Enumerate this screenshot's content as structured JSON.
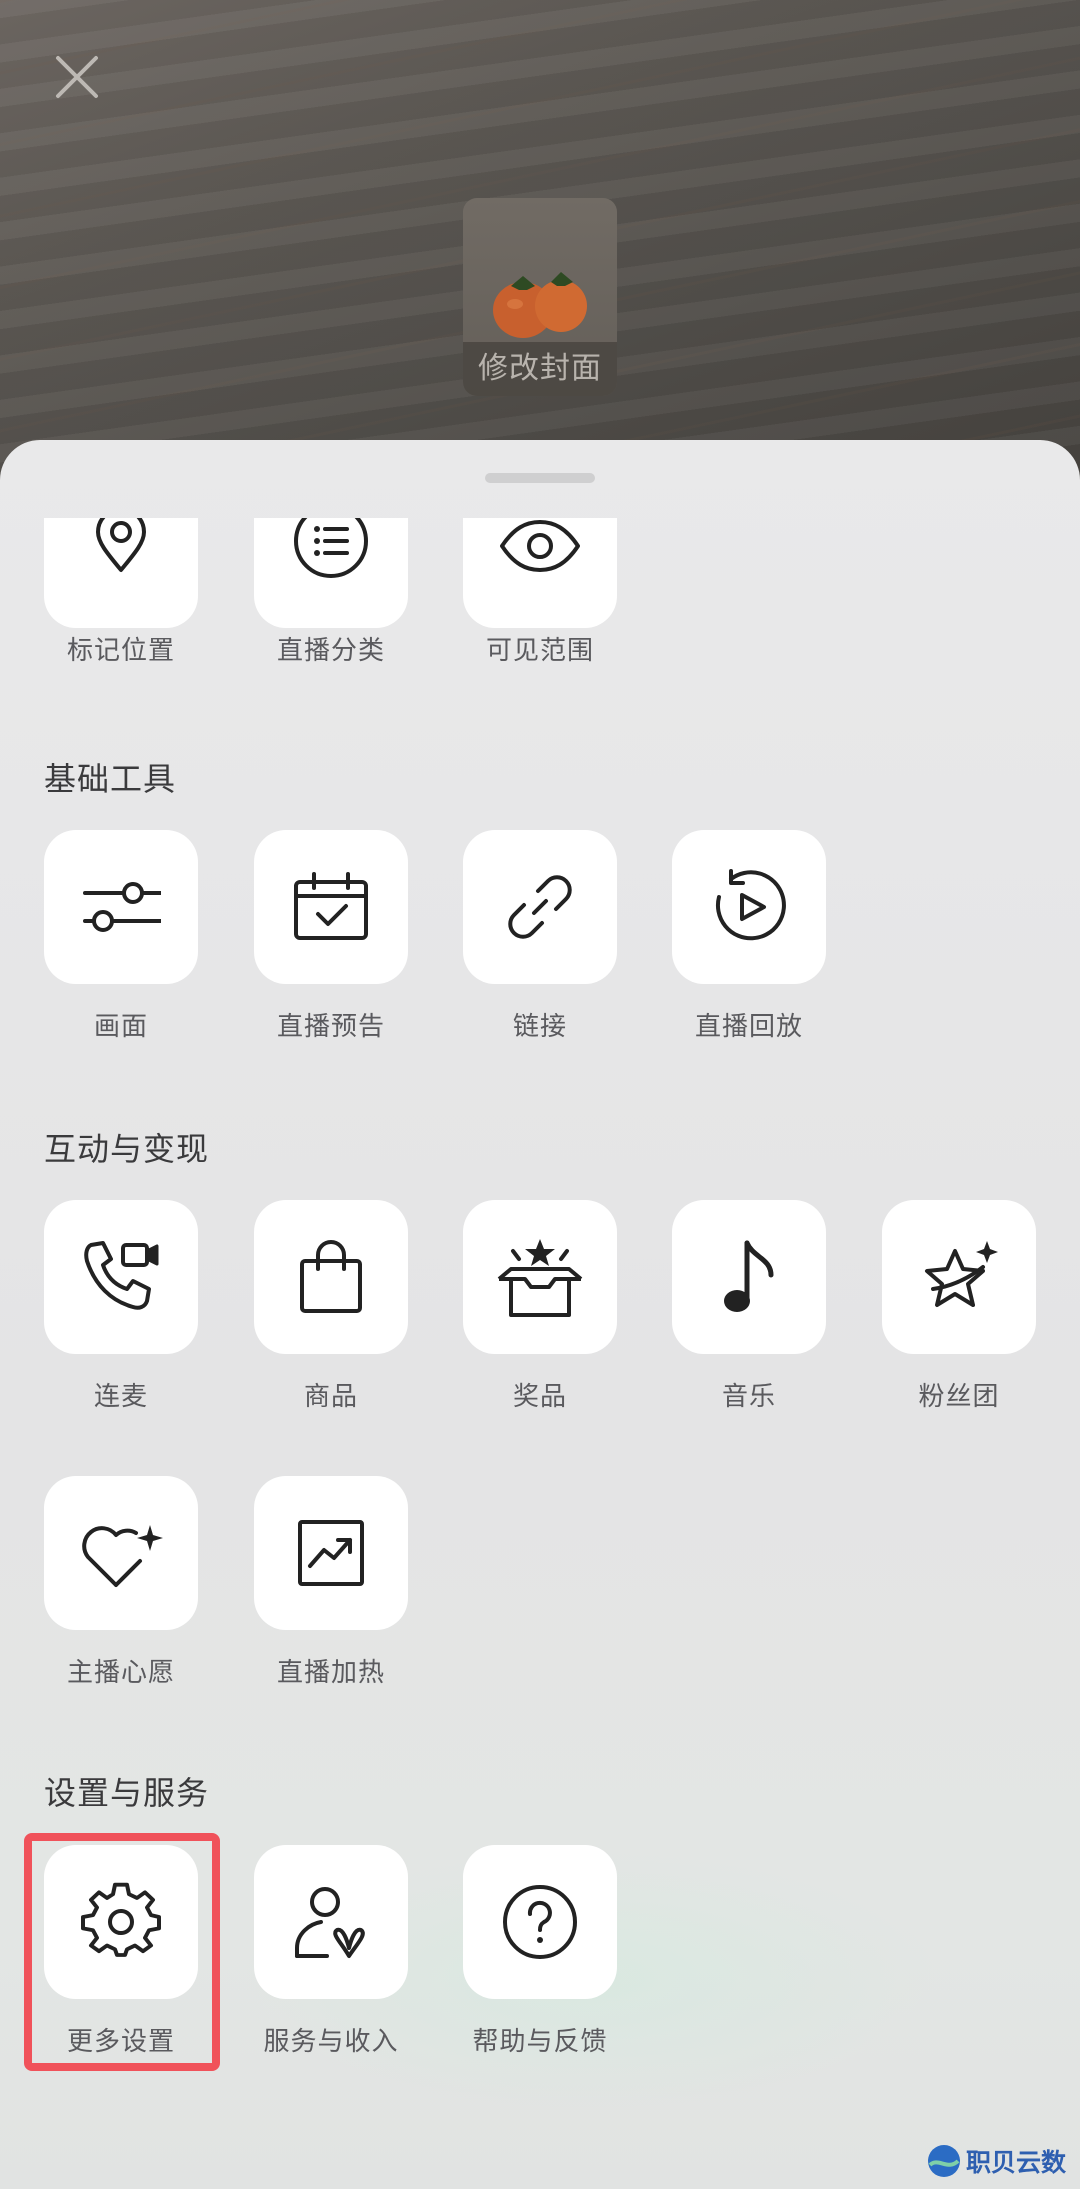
{
  "preview": {
    "cover_label": "修改封面"
  },
  "top_row": [
    {
      "label": "标记位置",
      "icon": "location-pin-icon"
    },
    {
      "label": "直播分类",
      "icon": "list-icon"
    },
    {
      "label": "可见范围",
      "icon": "eye-icon"
    }
  ],
  "sections": {
    "basic": {
      "title": "基础工具",
      "items": [
        {
          "label": "画面",
          "icon": "sliders-icon"
        },
        {
          "label": "直播预告",
          "icon": "calendar-check-icon"
        },
        {
          "label": "链接",
          "icon": "link-icon"
        },
        {
          "label": "直播回放",
          "icon": "replay-icon"
        }
      ]
    },
    "interact": {
      "title": "互动与变现",
      "items": [
        {
          "label": "连麦",
          "icon": "phone-video-icon"
        },
        {
          "label": "商品",
          "icon": "shopping-bag-icon"
        },
        {
          "label": "奖品",
          "icon": "gift-box-icon"
        },
        {
          "label": "音乐",
          "icon": "music-note-icon"
        },
        {
          "label": "粉丝团",
          "icon": "star-sparkle-icon"
        },
        {
          "label": "主播心愿",
          "icon": "heart-sparkle-icon"
        },
        {
          "label": "直播加热",
          "icon": "trend-up-icon"
        }
      ]
    },
    "settings": {
      "title": "设置与服务",
      "items": [
        {
          "label": "更多设置",
          "icon": "gear-icon"
        },
        {
          "label": "服务与收入",
          "icon": "person-butterfly-icon"
        },
        {
          "label": "帮助与反馈",
          "icon": "help-circle-icon"
        }
      ]
    }
  },
  "watermark": "职贝云数",
  "colors": {
    "highlight": "#f0525a",
    "tile": "#ffffff",
    "icon": "#222222"
  }
}
